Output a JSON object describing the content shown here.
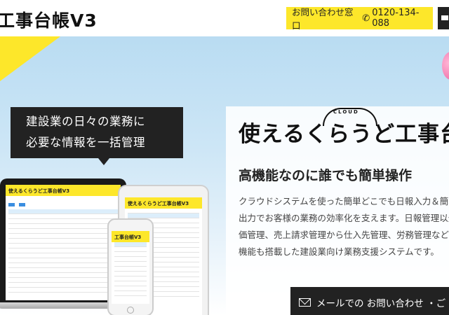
{
  "header": {
    "logo_text": "工事台帳V3",
    "contact_label": "お問い合わせ窓口",
    "phone_icon": "phone-icon",
    "phone_number": "0120-134-088"
  },
  "hero": {
    "callout_line1": "建設業の日々の業務に",
    "callout_line2": "必要な情報を一括管理",
    "brand_cloud_tag": "CLOUD",
    "brand_name": "使えるくらうど工事台",
    "catch_copy": "高機能なのに誰でも簡単操作",
    "description": [
      "クラウドシステムを使った簡単どこでも日報入力＆簡単",
      "出力でお客様の業務の効率化を支えます。日報管理以外",
      "価管理、売上請求管理から仕入先管理、労務管理などに",
      "機能も搭載した建設業向け業務支援システムです。"
    ],
    "mail_button_label": "メールでの お問い合わせ ・ご"
  },
  "devices": {
    "laptop_app_title": "使えるくらうど工事台帳V3",
    "tablet_app_title": "使えるくらうど工事台帳V3",
    "phone_app_title": "工事台帳V3"
  },
  "colors": {
    "accent_yellow": "#fde72a",
    "dark": "#222222",
    "sky": "#b9dcf2"
  }
}
